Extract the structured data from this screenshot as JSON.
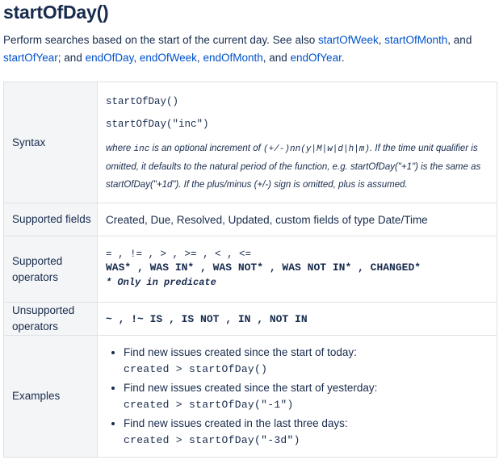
{
  "title": "startOfDay()",
  "intro": {
    "text1": "Perform searches based on the start of the current day. See also ",
    "link1": "startOfWeek",
    "sep1": ", ",
    "link2": "startOfMonth",
    "sep2": ", and ",
    "link3": "startOfYear",
    "sep3": "; and ",
    "link4": "endOfDay",
    "sep4": ", ",
    "link5": "endOfWeek",
    "sep5": ", ",
    "link6": "endOfMonth",
    "sep6": ", and ",
    "link7": "endOfYear",
    "end": "."
  },
  "table": {
    "syntax": {
      "label": "Syntax",
      "line1": "startOfDay()",
      "line2": "startOfDay(\"inc\")",
      "note_where": "where ",
      "note_inc": "inc",
      "note_mid": " is an optional increment of ",
      "note_pattern": "(+/-)nn(y|M|w|d|h|m)",
      "note_rest": ". If the time unit qualifier is omitted, it defaults to the natural period of the function, e.g. startOfDay(\"+1\") is the same as startOfDay(\"+1d\"). If the plus/minus (+/-) sign is omitted, plus is assumed."
    },
    "fields": {
      "label": "Supported fields",
      "value": "Created, Due, Resolved, Updated, custom fields of type Date/Time"
    },
    "operators": {
      "label": "Supported operators",
      "line1": "= , != , > , >= , < , <=",
      "line2": "WAS* , WAS IN* , WAS NOT* , WAS NOT IN* , CHANGED*",
      "note": "* Only in predicate"
    },
    "unsupported": {
      "label": "Unsupported operators",
      "value": "~ , !~ IS , IS NOT , IN , NOT IN"
    },
    "examples": {
      "label": "Examples",
      "items": [
        {
          "text": "Find new issues created since the start of today:",
          "code": "created > startOfDay()"
        },
        {
          "text": "Find new issues created since the start of yesterday:",
          "code": "created > startOfDay(\"-1\")"
        },
        {
          "text": "Find new issues created in the last three days:",
          "code": "created > startOfDay(\"-3d\")"
        }
      ]
    }
  }
}
